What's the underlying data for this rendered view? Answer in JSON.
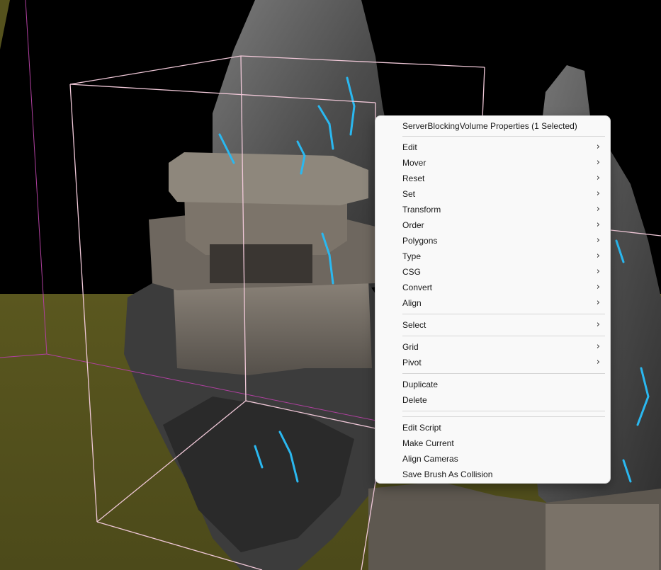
{
  "context_menu": {
    "header": "ServerBlockingVolume Properties (1 Selected)",
    "groups": [
      [
        {
          "label": "Edit",
          "submenu": true
        },
        {
          "label": "Mover",
          "submenu": true
        },
        {
          "label": "Reset",
          "submenu": true
        },
        {
          "label": "Set",
          "submenu": true
        },
        {
          "label": "Transform",
          "submenu": true
        },
        {
          "label": "Order",
          "submenu": true
        },
        {
          "label": "Polygons",
          "submenu": true
        },
        {
          "label": "Type",
          "submenu": true
        },
        {
          "label": "CSG",
          "submenu": true
        },
        {
          "label": "Convert",
          "submenu": true
        },
        {
          "label": "Align",
          "submenu": true
        }
      ],
      [
        {
          "label": "Select",
          "submenu": true
        }
      ],
      [
        {
          "label": "Grid",
          "submenu": true
        },
        {
          "label": "Pivot",
          "submenu": true
        }
      ],
      [
        {
          "label": "Duplicate",
          "submenu": false
        },
        {
          "label": "Delete",
          "submenu": false
        }
      ],
      [
        {
          "label": "Edit Script",
          "submenu": false
        },
        {
          "label": "Make Current",
          "submenu": false
        },
        {
          "label": "Align Cameras",
          "submenu": false
        },
        {
          "label": "Save Brush As Collision",
          "submenu": false
        }
      ]
    ],
    "submenu_glyph": "›"
  },
  "scene": {
    "sky_color": "#000000",
    "ground_color": "#55521d",
    "brush_wire_color": "#f0c8d8",
    "glow_color": "#2ab8f0"
  }
}
